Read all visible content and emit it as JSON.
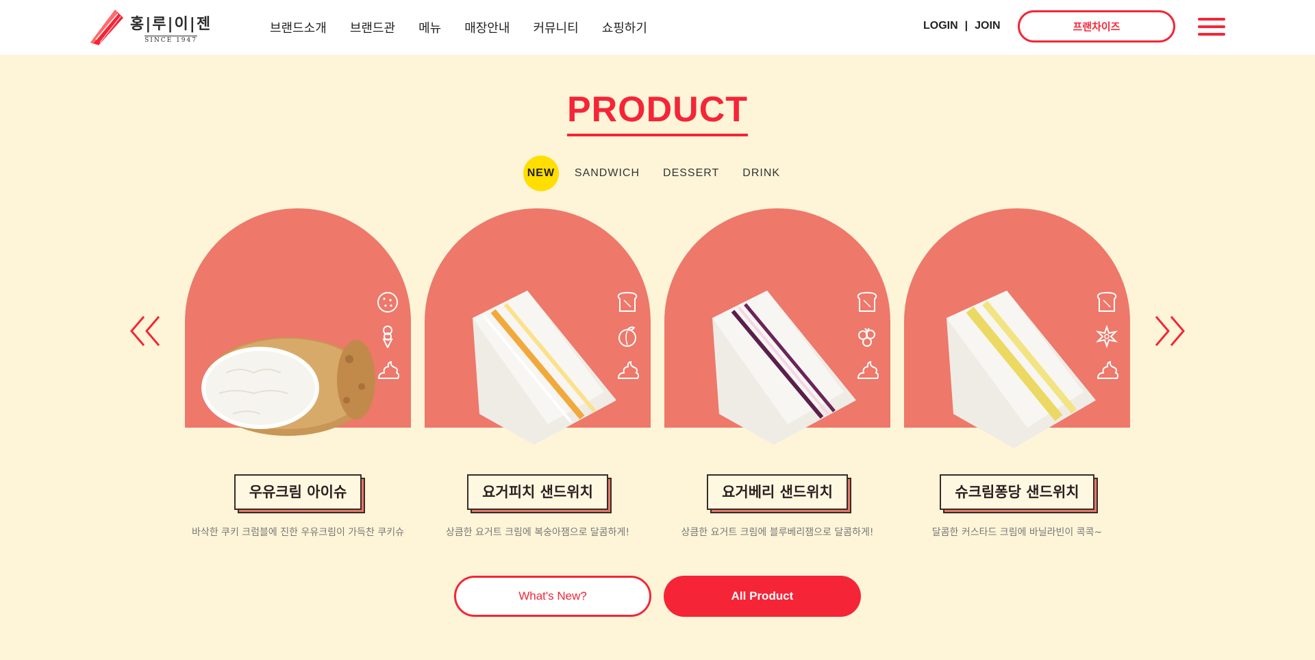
{
  "brand": {
    "name": "홍|루|이|젠",
    "since": "SINCE 1947",
    "accent": "#f52537"
  },
  "nav": {
    "items": [
      "브랜드소개",
      "브랜드관",
      "메뉴",
      "매장안내",
      "커뮤니티",
      "쇼핑하기"
    ]
  },
  "auth": {
    "login": "LOGIN",
    "separator": "|",
    "join": "JOIN"
  },
  "header": {
    "franchise_label": "프랜차이즈",
    "menu_icon": "hamburger-icon"
  },
  "product": {
    "title": "PRODUCT",
    "tabs": [
      {
        "label": "NEW",
        "active": true
      },
      {
        "label": "SANDWICH",
        "active": false
      },
      {
        "label": "DESSERT",
        "active": false
      },
      {
        "label": "DRINK",
        "active": false
      }
    ],
    "prev_icon": "double-chevron-left-icon",
    "next_icon": "double-chevron-right-icon",
    "items": [
      {
        "name": "우유크림 아이슈",
        "desc": "바삭한 쿠키 크럼블에 진한 우유크림이 가득찬 쿠키슈",
        "image": "cream-puff",
        "ingredients": [
          "cookie-icon",
          "ice-cream-icon",
          "cream-icon"
        ]
      },
      {
        "name": "요거피치 샌드위치",
        "desc": "상큼한 요거트 크림에 복숭아잼으로 달콤하게!",
        "image": "peach-sandwich",
        "ingredients": [
          "bread-icon",
          "peach-icon",
          "cream-icon"
        ]
      },
      {
        "name": "요거베리 샌드위치",
        "desc": "상큼한 요거트 크림에 블루베리잼으로 달콤하게!",
        "image": "blueberry-sandwich",
        "ingredients": [
          "bread-icon",
          "berry-icon",
          "cream-icon"
        ]
      },
      {
        "name": "슈크림퐁당 샌드위치",
        "desc": "달콤한 커스타드 크림에 바닐라빈이 콕콕~",
        "image": "custard-sandwich",
        "ingredients": [
          "bread-icon",
          "vanilla-flower-icon",
          "cream-icon"
        ]
      }
    ],
    "buttons": {
      "whats_new": "What's New?",
      "all_product": "All Product"
    },
    "colors": {
      "background": "#fef5d8",
      "arch": "#ee786a",
      "tab_active": "#ffde00"
    }
  }
}
